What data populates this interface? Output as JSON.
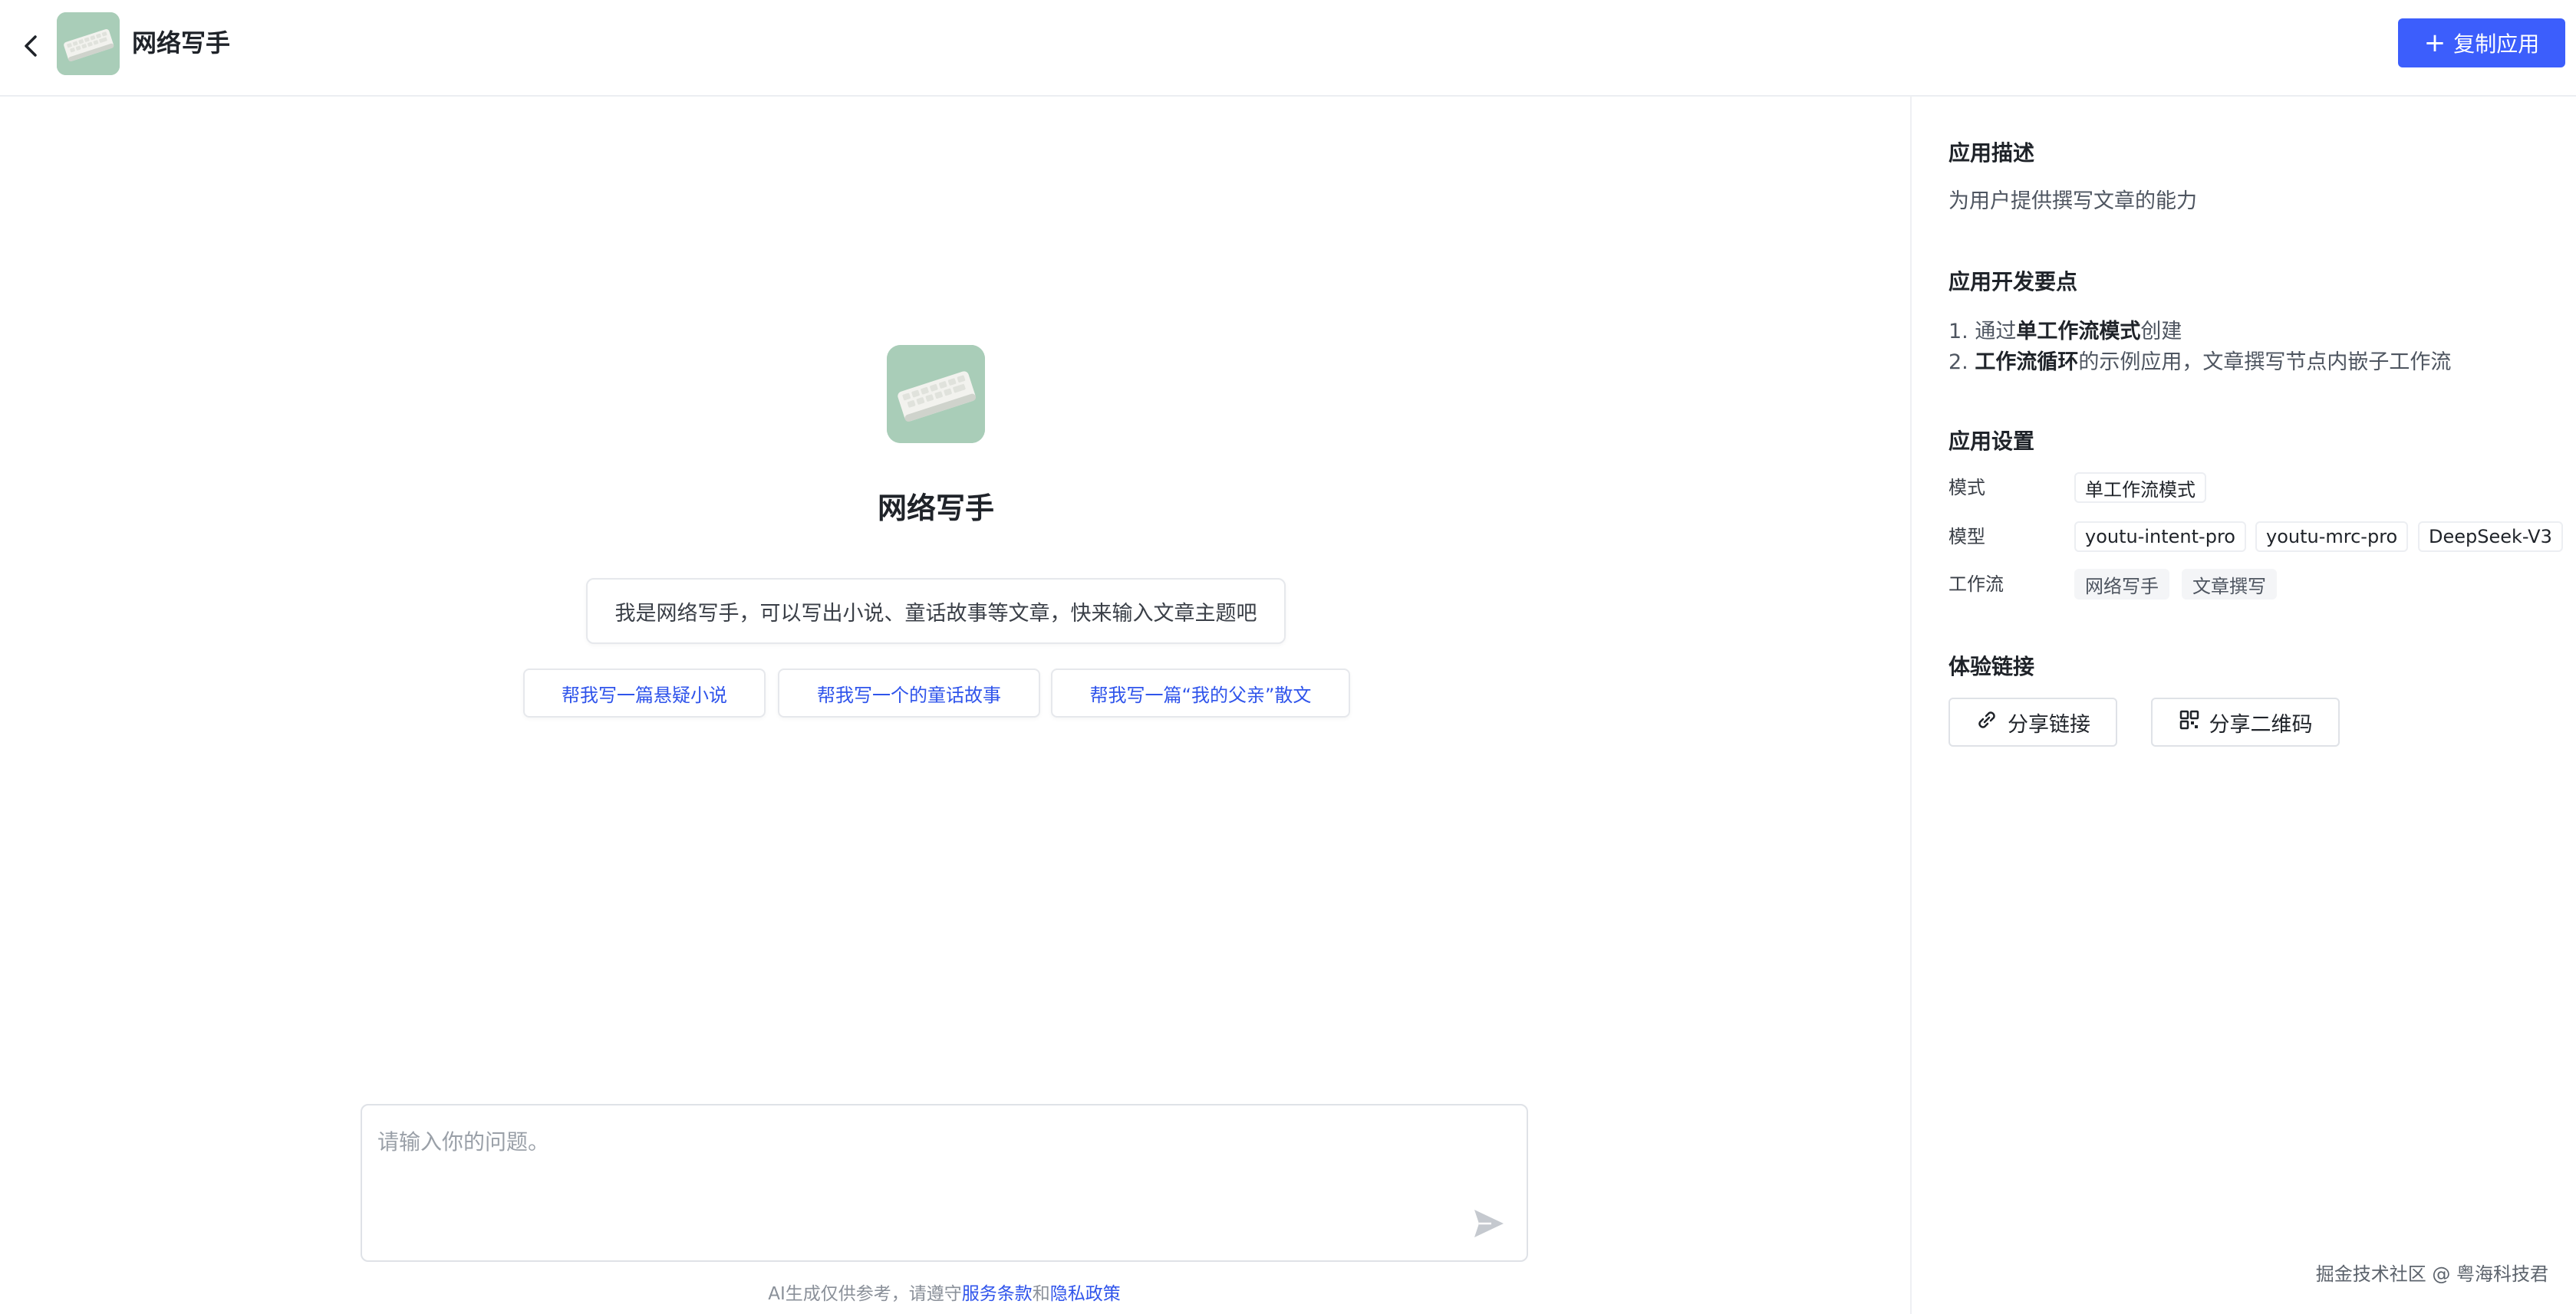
{
  "header": {
    "title": "网络写手",
    "copy_button_label": "复制应用"
  },
  "welcome": {
    "title": "网络写手",
    "intro": "我是网络写手，可以写出小说、童话故事等文章，快来输入文章主题吧",
    "suggestions": [
      "帮我写一篇悬疑小说",
      "帮我写一个的童话故事",
      "帮我写一篇“我的父亲”散文"
    ]
  },
  "input": {
    "placeholder": "请输入你的问题。",
    "value": ""
  },
  "footer": {
    "prefix": "AI生成仅供参考，请遵守",
    "terms_link": "服务条款",
    "and": "和",
    "privacy_link": "隐私政策"
  },
  "right_panel": {
    "description_heading": "应用描述",
    "description_text": "为用户提供撰写文章的能力",
    "dev_points_heading": "应用开发要点",
    "dev_point_1": {
      "prefix": "1. 通过",
      "bold": "单工作流模式",
      "suffix": "创建"
    },
    "dev_point_2": {
      "prefix": "2. ",
      "bold": "工作流循环",
      "suffix": "的示例应用，文章撰写节点内嵌子工作流"
    },
    "settings_heading": "应用设置",
    "mode_label": "模式",
    "mode_value": "单工作流模式",
    "model_label": "模型",
    "models": [
      "youtu-intent-pro",
      "youtu-mrc-pro",
      "DeepSeek-V3"
    ],
    "workflow_label": "工作流",
    "workflows": [
      "网络写手",
      "文章撰写"
    ],
    "links_heading": "体验链接",
    "share_link_label": "分享链接",
    "share_qr_label": "分享二维码"
  },
  "credit": "掘金技术社区 @ 粤海科技君",
  "colors": {
    "primary": "#3c5efc",
    "link": "#2f54eb",
    "icon_bg": "#a9cdb8"
  }
}
